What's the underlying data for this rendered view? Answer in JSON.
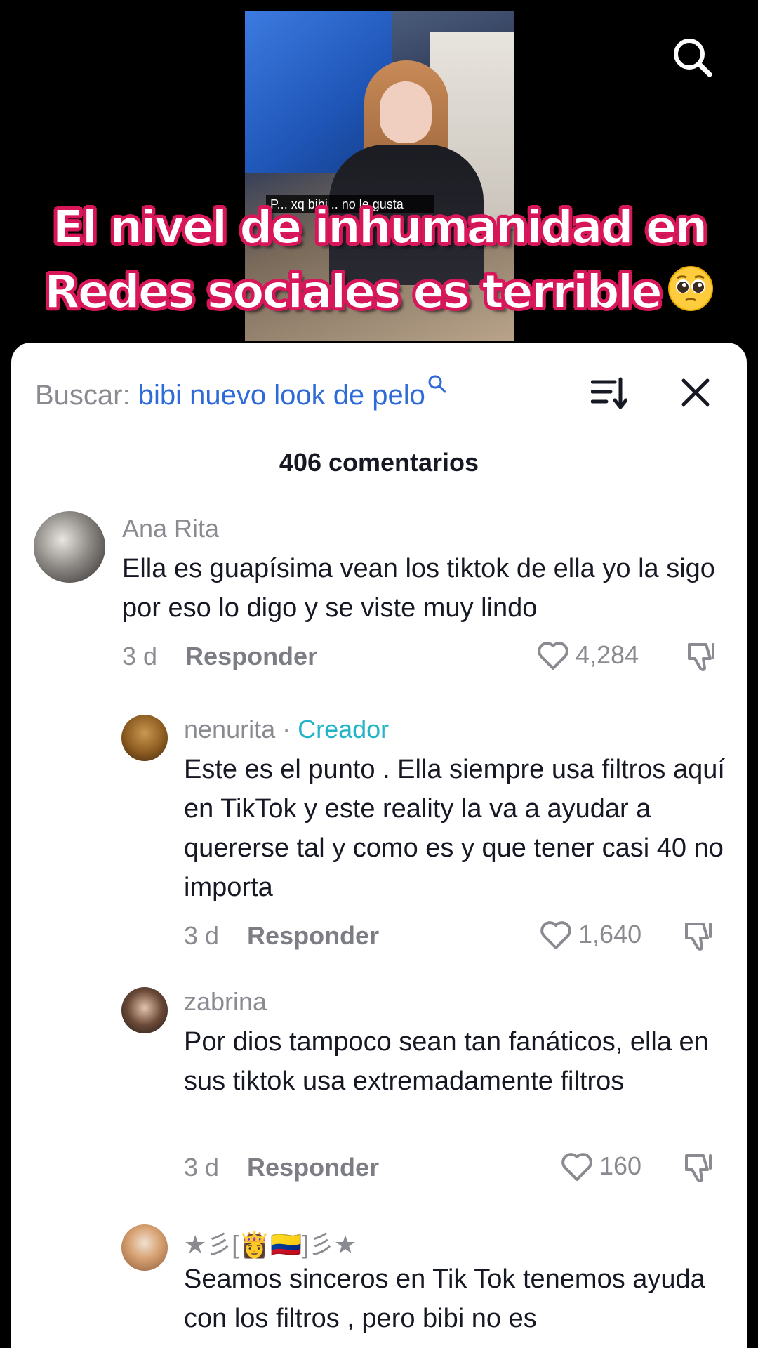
{
  "video": {
    "caption": "P... xq bibi .. no le gusta",
    "overlay_line1": "El nivel de inhumanidad en",
    "overlay_line2": "Redes sociales es terrible",
    "overlay_emoji": "pleading-face-emoji"
  },
  "sheet": {
    "search_prefix": "Buscar: ",
    "search_query": "bibi nuevo look de pelo",
    "comment_count": "406 comentarios"
  },
  "comments": [
    {
      "username": "Ana Rita",
      "text": "Ella es guapísima vean los tiktok de ella yo la sigo por eso lo digo y se viste muy lindo",
      "time": "3 d",
      "reply_label": "Responder",
      "likes": "4,284"
    },
    {
      "username": "nenurita",
      "separator": " · ",
      "badge": "Creador",
      "text": "Este es el punto . Ella siempre usa filtros aquí en TikTok y este reality la va a ayudar a quererse tal y como es y que tener casi 40 no importa",
      "time": "3 d",
      "reply_label": "Responder",
      "likes": "1,640"
    },
    {
      "username": "zabrina",
      "text": "Por dios tampoco sean tan fanáticos, ella en sus tiktok usa extremadamente filtros",
      "time": "3 d",
      "reply_label": "Responder",
      "likes": "160"
    },
    {
      "username": "★彡[👸🇨🇴]彡★",
      "text": "Seamos sinceros en Tik Tok tenemos ayuda con los filtros , pero bibi no es"
    }
  ],
  "colors": {
    "accent_link": "#2f6bd8",
    "creator_badge": "#23b4c8",
    "overlay_outline": "#d8175a"
  }
}
